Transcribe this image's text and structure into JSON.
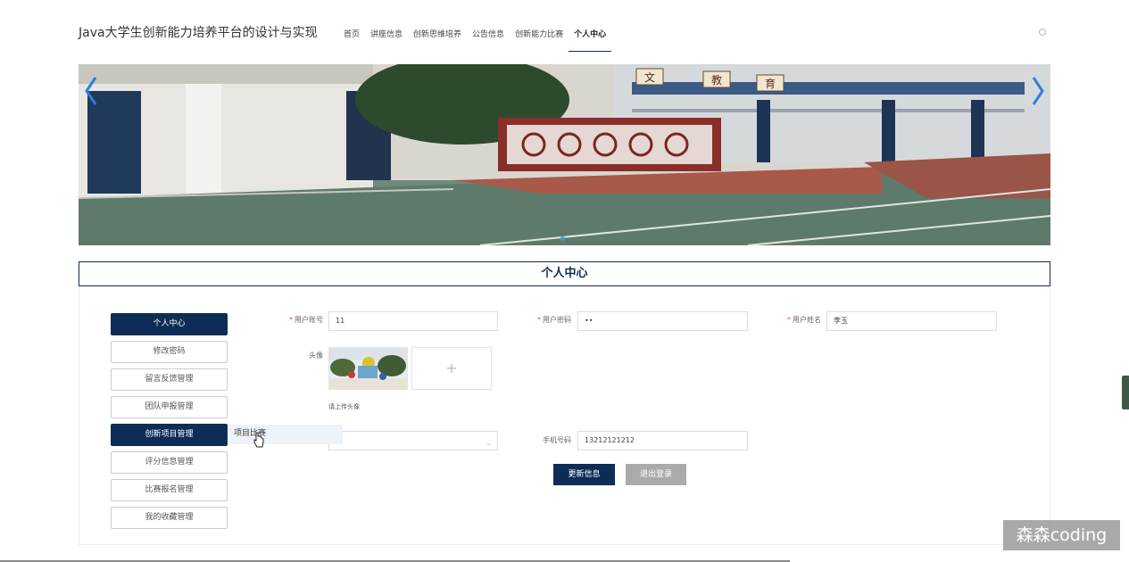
{
  "header": {
    "site_title": "Java大学生创新能力培养平台的设计与实现",
    "nav": [
      {
        "label": "首页",
        "active": false
      },
      {
        "label": "讲座信息",
        "active": false
      },
      {
        "label": "创新思维培养",
        "active": false
      },
      {
        "label": "公告信息",
        "active": false
      },
      {
        "label": "创新能力比赛",
        "active": false
      },
      {
        "label": "个人中心",
        "active": true
      }
    ]
  },
  "banner": {
    "sign_chars": [
      "文",
      "教",
      "育"
    ],
    "slide_count": 1
  },
  "section_title": "个人中心",
  "sidebar": {
    "items": [
      {
        "label": "个人中心",
        "active": true
      },
      {
        "label": "修改密码",
        "active": false
      },
      {
        "label": "留言反馈管理",
        "active": false
      },
      {
        "label": "团队申报管理",
        "active": false
      },
      {
        "label": "创新项目管理",
        "active": true
      },
      {
        "label": "评分信息管理",
        "active": false
      },
      {
        "label": "比赛报名管理",
        "active": false
      },
      {
        "label": "我的收藏管理",
        "active": false
      }
    ],
    "dropdown_item": "项目比赛"
  },
  "form": {
    "account_label": "用户账号",
    "account_value": "11",
    "password_label": "用户密码",
    "password_value": "••",
    "name_label": "用户姓名",
    "name_value": "李玉",
    "avatar_label": "头像",
    "upload_hint": "请上传头像",
    "phone_label": "手机号码",
    "phone_value": "13212121212",
    "required_mark": "*",
    "add_symbol": "+"
  },
  "buttons": {
    "update": "更新信息",
    "logout": "退出登录"
  },
  "watermark": "森森coding",
  "colors": {
    "primary": "#0d2d57",
    "gray_button": "#aaaaaa",
    "required": "#e55555"
  }
}
